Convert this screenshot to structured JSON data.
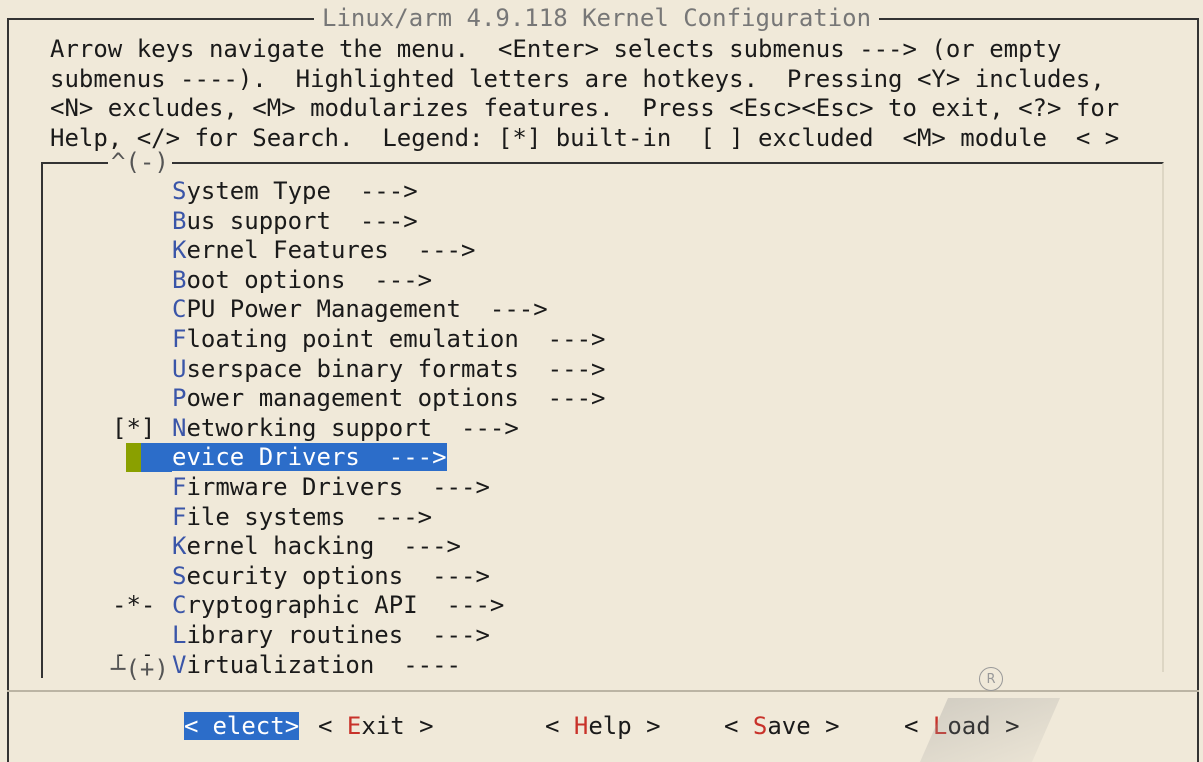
{
  "window": {
    "title": "Linux/arm 4.9.118 Kernel Configuration"
  },
  "help_text": "Arrow keys navigate the menu.  <Enter> selects submenus ---> (or empty\nsubmenus ----).  Highlighted letters are hotkeys.  Pressing <Y> includes,\n<N> excludes, <M> modularizes features.  Press <Esc><Esc> to exit, <?> for\nHelp, </> for Search.  Legend: [*] built-in  [ ] excluded  <M> module  < >",
  "scroll": {
    "top": "^(-)",
    "bottom": "┴(+)"
  },
  "menu": {
    "selected_index": 9,
    "items": [
      {
        "mark": "",
        "hotkey": "S",
        "rest": "ystem Type  --->"
      },
      {
        "mark": "",
        "hotkey": "B",
        "rest": "us support  --->"
      },
      {
        "mark": "",
        "hotkey": "K",
        "rest": "ernel Features  --->"
      },
      {
        "mark": "",
        "hotkey": "B",
        "rest": "oot options  --->"
      },
      {
        "mark": "",
        "hotkey": "C",
        "rest": "PU Power Management  --->"
      },
      {
        "mark": "",
        "hotkey": "F",
        "rest": "loating point emulation  --->"
      },
      {
        "mark": "",
        "hotkey": "U",
        "rest": "serspace binary formats  --->"
      },
      {
        "mark": "",
        "hotkey": "P",
        "rest": "ower management options  --->"
      },
      {
        "mark": "[*]",
        "hotkey": "N",
        "rest": "etworking support  --->"
      },
      {
        "mark": "",
        "hotkey": "",
        "rest": "evice Drivers  --->"
      },
      {
        "mark": "",
        "hotkey": "F",
        "rest": "irmware Drivers  --->"
      },
      {
        "mark": "",
        "hotkey": "F",
        "rest": "ile systems  --->"
      },
      {
        "mark": "",
        "hotkey": "K",
        "rest": "ernel hacking  --->"
      },
      {
        "mark": "",
        "hotkey": "S",
        "rest": "ecurity options  --->"
      },
      {
        "mark": "-*-",
        "hotkey": "C",
        "rest": "ryptographic API  --->"
      },
      {
        "mark": "",
        "hotkey": "L",
        "rest": "ibrary routines  --->"
      },
      {
        "mark": "[ ]",
        "hotkey": "V",
        "rest": "irtualization  ----"
      }
    ]
  },
  "buttons": [
    {
      "pre": "<",
      "hotkey": "",
      "rest": "elect>",
      "active": true
    },
    {
      "pre": "< ",
      "hotkey": "E",
      "rest": "xit >",
      "active": false
    },
    {
      "pre": "< ",
      "hotkey": "H",
      "rest": "elp >",
      "active": false
    },
    {
      "pre": "< ",
      "hotkey": "S",
      "rest": "ave >",
      "active": false
    },
    {
      "pre": "< ",
      "hotkey": "L",
      "rest": "oad >",
      "active": false
    }
  ],
  "colors": {
    "background": "#f0e9d9",
    "selection": "#2c6dc9",
    "hotkey_menu": "#3a55a8",
    "hotkey_button": "#c8322a",
    "cursor": "#8aa000"
  },
  "icons": [
    "registered-trademark-icon",
    "watermark-logo-icon"
  ]
}
